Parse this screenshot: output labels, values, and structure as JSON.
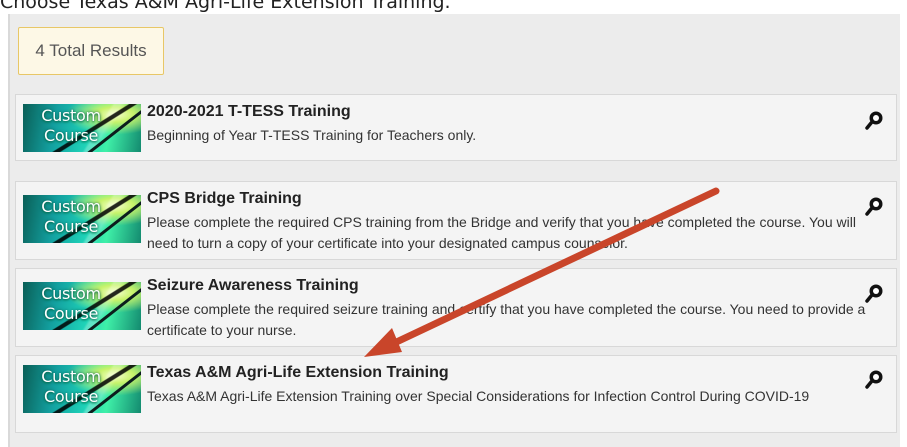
{
  "instruction": "Choose Texas A&M Agri-Life Extension Training.",
  "results_badge": "4 Total Results",
  "thumbnail": {
    "line1": "Custom",
    "line2": "Course"
  },
  "courses": [
    {
      "title": "2020-2021 T-TESS Training",
      "description": "Beginning of Year T-TESS Training for Teachers only."
    },
    {
      "title": "CPS Bridge Training",
      "description": "Please complete the required CPS training from the Bridge and verify that you have completed the course.  You will need to turn a copy of your certificate into your designated campus counselor."
    },
    {
      "title": "Seizure Awareness Training",
      "description": "Please complete the required seizure training and certify that you have completed the course.  You need to provide a certificate to your nurse."
    },
    {
      "title": "Texas A&M Agri-Life Extension Training",
      "description": "Texas A&M Agri-Life Extension Training over Special Considerations for Infection Control During COVID-19"
    }
  ],
  "icons": {
    "view": "magnifier-icon",
    "annotation": "arrow-annotation"
  },
  "colors": {
    "arrow": "#c9452a",
    "badge_border": "#e8c766",
    "badge_bg": "#fdf8e6",
    "panel_bg": "#ececec"
  }
}
